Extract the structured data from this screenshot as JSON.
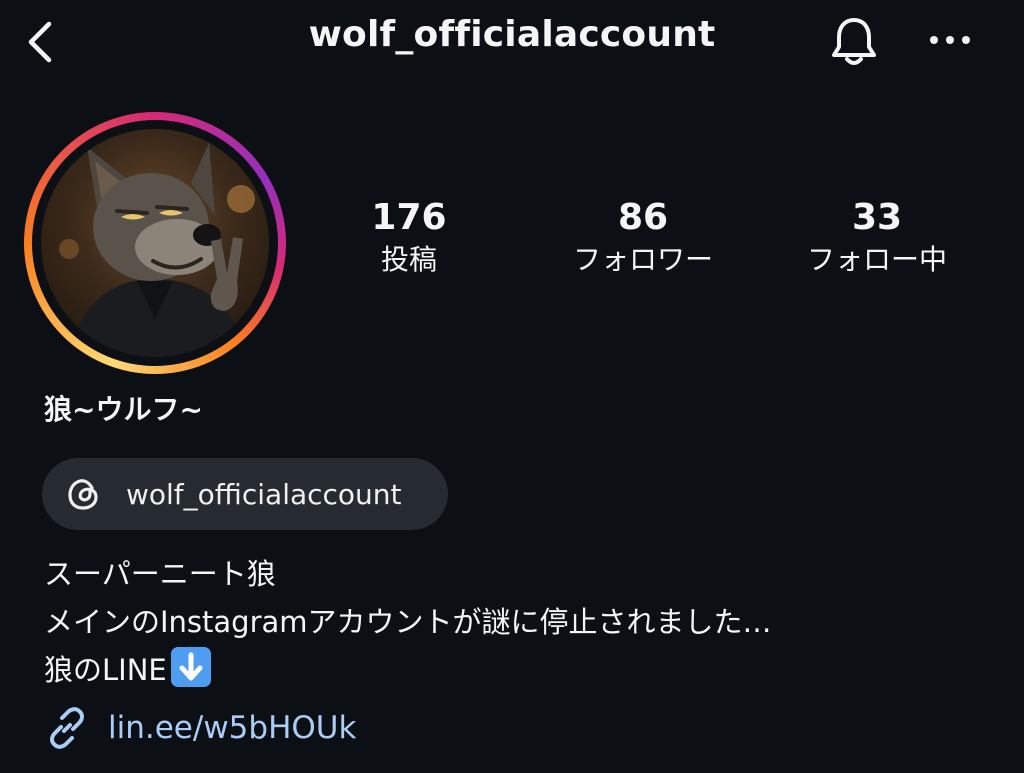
{
  "header": {
    "title": "wolf_officialaccount",
    "back_icon": "chevron-left-icon",
    "bell_icon": "bell-icon",
    "more_icon": "more-horizontal-icon"
  },
  "profile": {
    "avatar_alt": "wolf avatar",
    "stats": [
      {
        "value": "176",
        "label": "投稿"
      },
      {
        "value": "86",
        "label": "フォロワー"
      },
      {
        "value": "33",
        "label": "フォロー中"
      }
    ],
    "display_name": "狼~ウルフ~",
    "threads": {
      "icon": "threads-icon",
      "label": "wolf_officialaccount"
    },
    "bio_lines": [
      "スーパーニート狼",
      "メインのInstagramアカウントが謎に停止されました…",
      "狼のLINE"
    ],
    "bio_emoji": "down-arrow-emoji",
    "link": {
      "icon": "link-icon",
      "text": "lin.ee/w5bHOUk"
    }
  },
  "colors": {
    "background": "#0c0f14",
    "pill": "#262a31",
    "link": "#a9cdf7",
    "emoji_blue": "#4f9df0"
  }
}
